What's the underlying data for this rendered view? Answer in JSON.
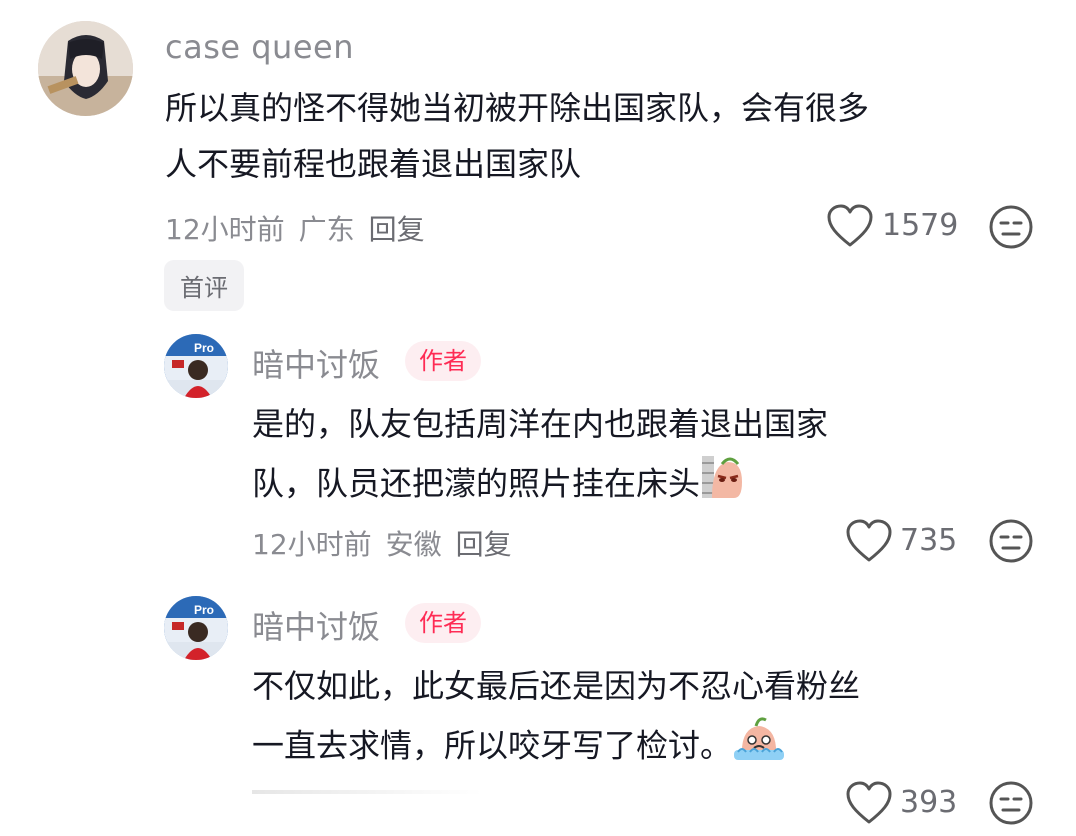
{
  "comment": {
    "username": "case queen",
    "text_line1": "所以真的怪不得她当初被开除出国家队，会有很多",
    "text_line2": "人不要前程也跟着退出国家队",
    "time": "12小时前",
    "location": "广东",
    "reply_label": "回复",
    "likes": "1579",
    "badge": "首评"
  },
  "replies": [
    {
      "username": "暗中讨饭",
      "author_tag": "作者",
      "text_line1": "是的，队友包括周洋在内也跟着退出国家",
      "text_line2": "队，队员还把濛的照片挂在床头",
      "time": "12小时前",
      "location": "安徽",
      "reply_label": "回复",
      "likes": "735"
    },
    {
      "username": "暗中讨饭",
      "author_tag": "作者",
      "text_line1": "不仅如此，此女最后还是因为不忍心看粉丝",
      "text_line2": "一直去求情，所以咬牙写了检讨。",
      "likes": "393"
    }
  ],
  "icons": {
    "like": "heart-outline-icon",
    "dislike": "neutral-face-icon",
    "emoji_1": "peeking-wall-emoji",
    "emoji_2": "crying-emoji"
  },
  "colors": {
    "author_tag": "#fe2c55",
    "author_tag_bg": "#fdeef1",
    "meta_text": "#8a8b91"
  }
}
